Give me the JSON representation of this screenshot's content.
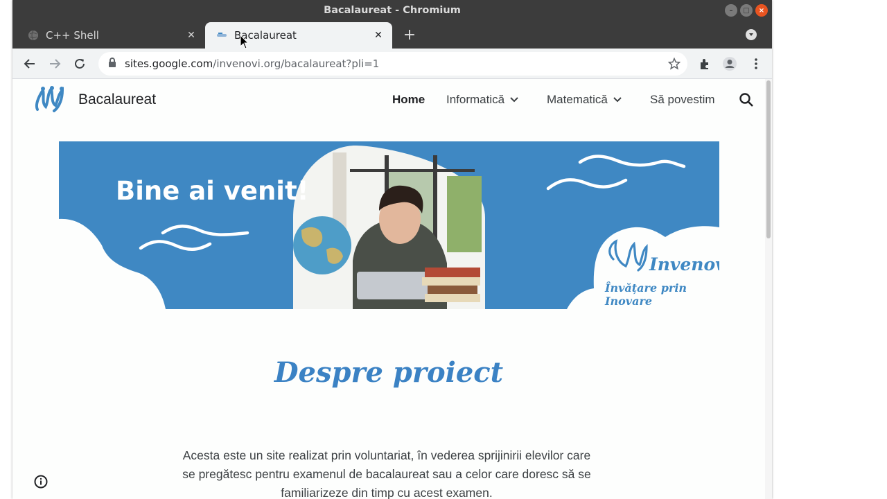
{
  "window": {
    "title": "Bacalaureat - Chromium"
  },
  "tabs": [
    {
      "label": "C++ Shell",
      "active": false
    },
    {
      "label": "Bacalaureat",
      "active": true
    }
  ],
  "address_bar": {
    "host": "sites.google.com",
    "path": "/invenovi.org/bacalaureat?pli=1"
  },
  "site": {
    "title": "Bacalaureat",
    "nav": [
      {
        "label": "Home",
        "selected": true,
        "dropdown": false
      },
      {
        "label": "Informatică",
        "selected": false,
        "dropdown": true
      },
      {
        "label": "Matematică",
        "selected": false,
        "dropdown": true
      },
      {
        "label": "Să povestim",
        "selected": false,
        "dropdown": false
      }
    ]
  },
  "banner": {
    "heading": "Bine ai venit!",
    "logo_name": "Invenovi",
    "logo_tagline": "Învățare prin Inovare"
  },
  "about": {
    "title": "Despre proiect",
    "lines": [
      "Acesta este un site realizat prin voluntariat, în vederea sprijinirii elevilor care",
      "se pregătesc pentru examenul de bacalaureat sau a celor care doresc să se",
      "familiarizeze din timp cu acest examen."
    ]
  },
  "colors": {
    "accent": "#3f88c3",
    "titlebar": "#3c3c3c",
    "toolbar": "#f1f3f4"
  }
}
